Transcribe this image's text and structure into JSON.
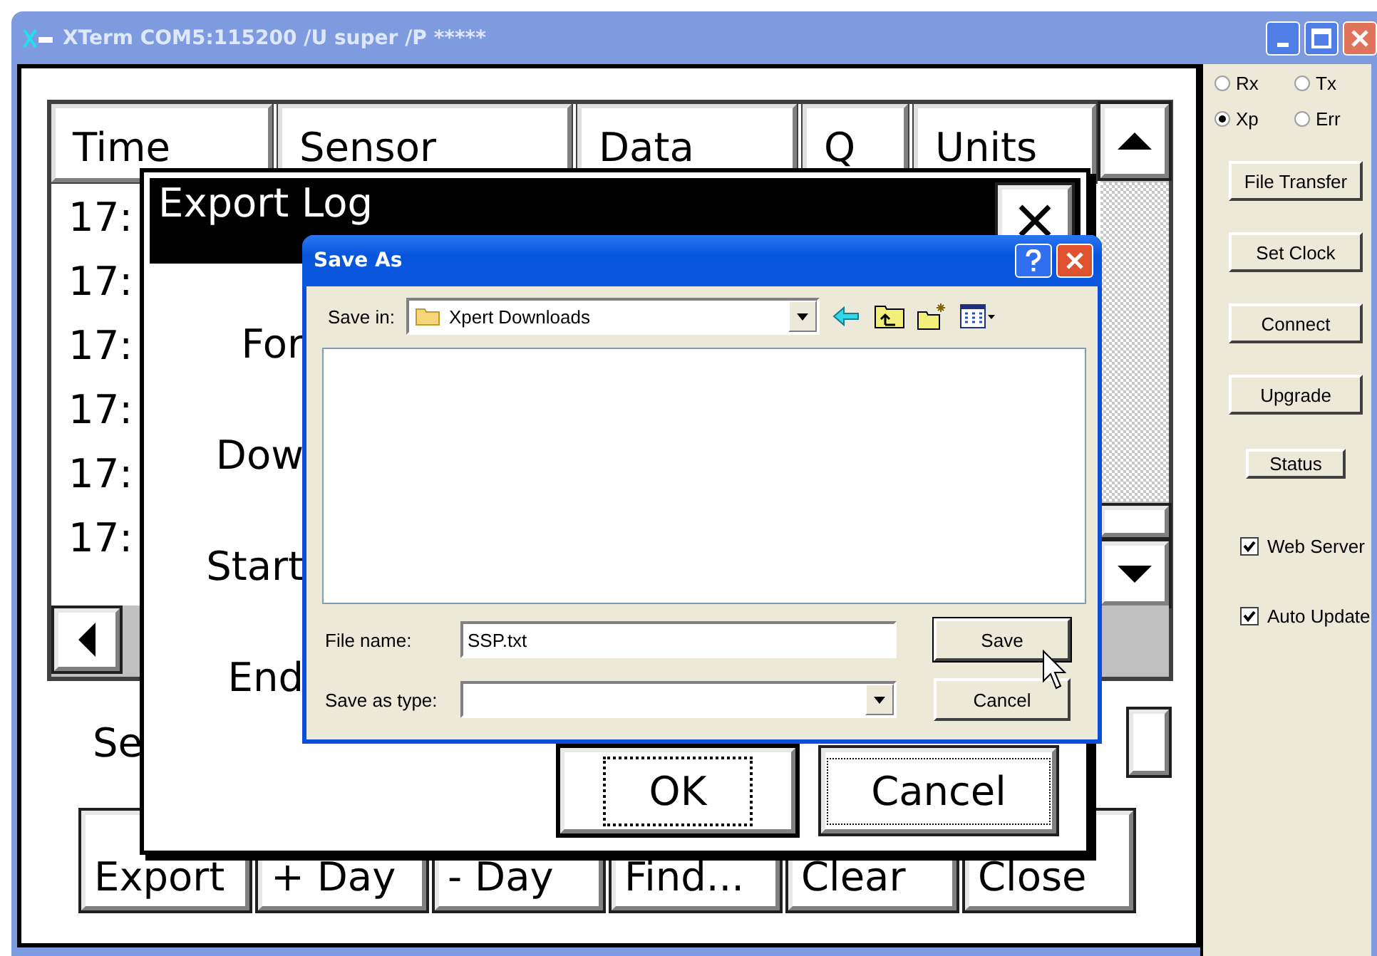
{
  "window": {
    "title": "XTerm COM5:115200 /U super /P *****"
  },
  "log_table": {
    "columns": [
      "Time",
      "Sensor",
      "Data",
      "Q",
      "Units"
    ],
    "rows": [
      "17:",
      "17:",
      "17:",
      "17:",
      "17:",
      "17:"
    ]
  },
  "side_label": "Se",
  "bottom_buttons": [
    "Export",
    "+ Day",
    "- Day",
    "Find...",
    "Clear",
    "Close"
  ],
  "export_dialog": {
    "title": "Export Log",
    "labels": [
      "For",
      "Dow",
      "Start",
      "End"
    ],
    "buttons": [
      {
        "label": "OK",
        "focused": true
      },
      {
        "label": "Cancel",
        "focused": false
      }
    ]
  },
  "save_dialog": {
    "title": "Save As",
    "save_in_label": "Save in:",
    "save_in_value": "Xpert Downloads",
    "file_name_label": "File name:",
    "file_name_value": "SSP.txt",
    "type_label": "Save as type:",
    "buttons": [
      "Save",
      "Cancel"
    ]
  },
  "side_panel": {
    "radios": [
      {
        "label": "Rx",
        "selected": false
      },
      {
        "label": "Tx",
        "selected": false
      },
      {
        "label": "Xp",
        "selected": true
      },
      {
        "label": "Err",
        "selected": false
      }
    ],
    "buttons": [
      "File Transfer",
      "Set Clock",
      "Connect",
      "Upgrade",
      "Status"
    ],
    "checkboxes": [
      {
        "label": "Web Server",
        "checked": true
      },
      {
        "label": "Auto Update",
        "checked": true
      }
    ]
  }
}
